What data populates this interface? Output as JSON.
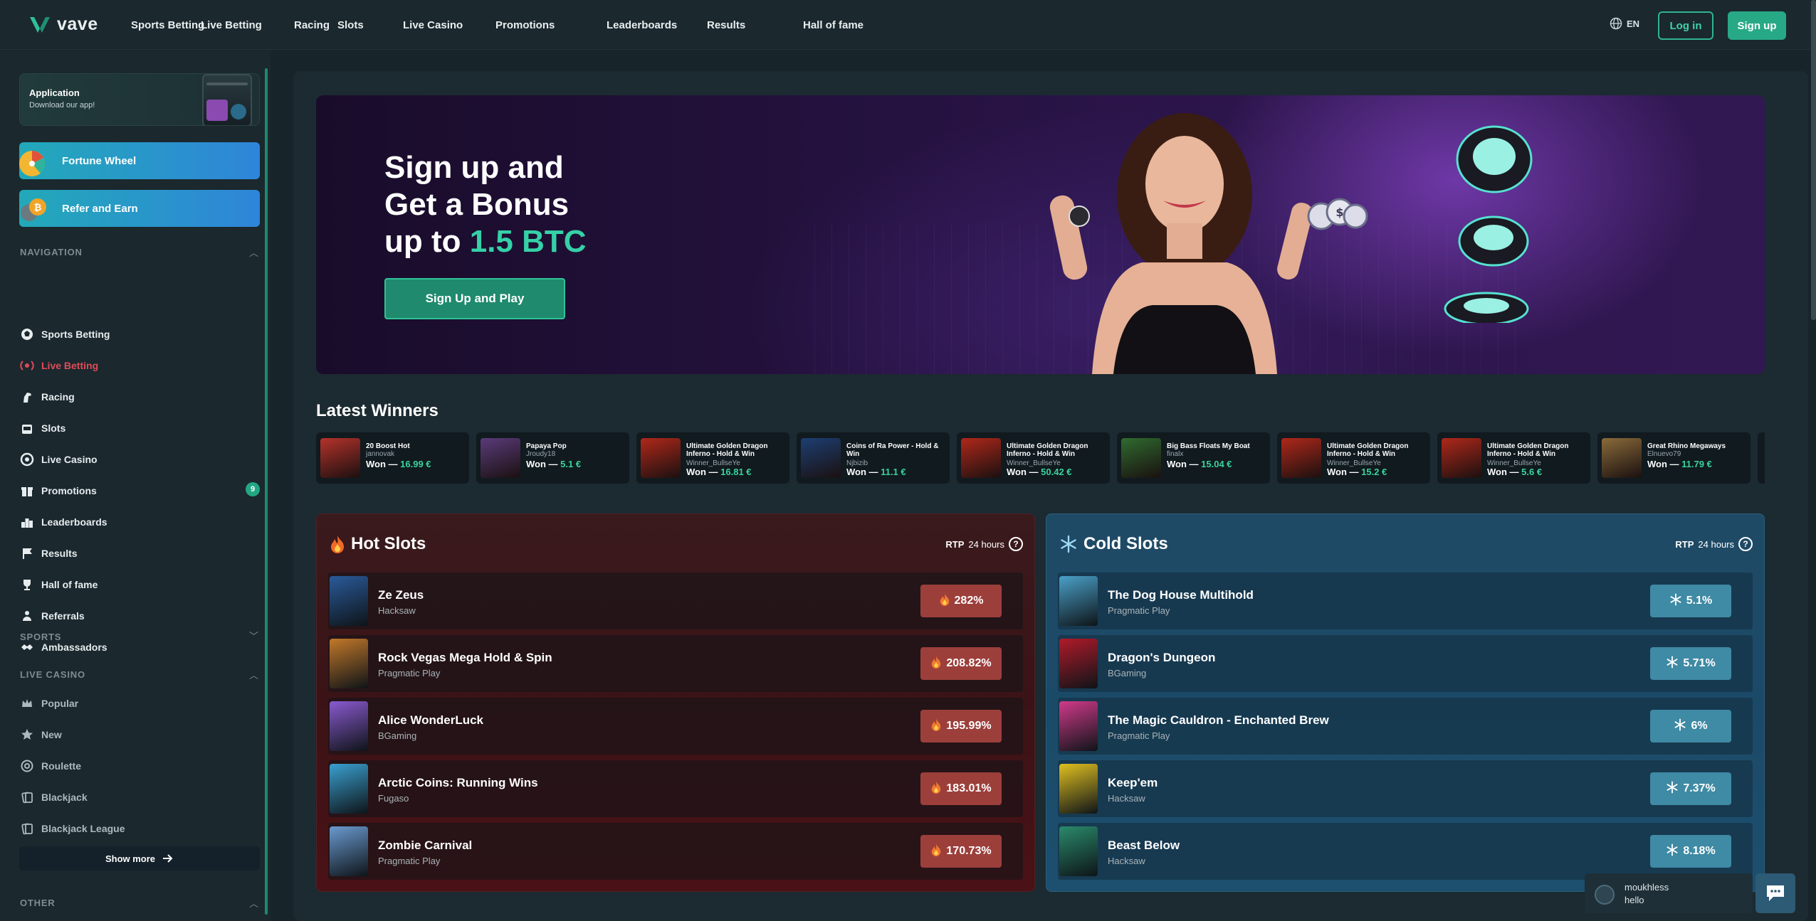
{
  "brand": {
    "name": "vave"
  },
  "topnav": [
    "Sports Betting",
    "Live Betting",
    "Racing",
    "Slots",
    "Live Casino",
    "Promotions",
    "Leaderboards",
    "Results",
    "Hall of fame"
  ],
  "lang": "EN",
  "auth": {
    "login": "Log in",
    "signup": "Sign up"
  },
  "sidebar": {
    "app": {
      "title": "Application",
      "subtitle": "Download our app!"
    },
    "promos": [
      "Fortune Wheel",
      "Refer and Earn"
    ],
    "navigation_title": "NAVIGATION",
    "navigation": [
      {
        "label": "Sports Betting",
        "icon": "football-icon"
      },
      {
        "label": "Live Betting",
        "icon": "live-icon",
        "active": true
      },
      {
        "label": "Racing",
        "icon": "horse-icon"
      },
      {
        "label": "Slots",
        "icon": "slot-machine-icon"
      },
      {
        "label": "Live Casino",
        "icon": "chip-icon"
      },
      {
        "label": "Promotions",
        "icon": "gift-icon",
        "badge": "9"
      },
      {
        "label": "Leaderboards",
        "icon": "leaderboard-icon"
      },
      {
        "label": "Results",
        "icon": "flag-icon"
      },
      {
        "label": "Hall of fame",
        "icon": "trophy-icon"
      },
      {
        "label": "Referrals",
        "icon": "referral-icon"
      },
      {
        "label": "Ambassadors",
        "icon": "handshake-icon"
      }
    ],
    "sports_title": "SPORTS",
    "live_casino_title": "LIVE CASINO",
    "live_casino": [
      {
        "label": "Popular",
        "icon": "crown-icon"
      },
      {
        "label": "New",
        "icon": "star-icon"
      },
      {
        "label": "Roulette",
        "icon": "roulette-icon"
      },
      {
        "label": "Blackjack",
        "icon": "cards-icon"
      },
      {
        "label": "Blackjack League",
        "icon": "cards-icon"
      }
    ],
    "show_more": "Show more",
    "other_title": "OTHER"
  },
  "banner": {
    "line1": "Sign up and",
    "line2": "Get a Bonus",
    "line3_prefix": "up to ",
    "line3_accent": "1.5 BTC",
    "cta": "Sign Up and Play"
  },
  "latest_winners": {
    "title": "Latest Winners",
    "won_prefix": "Won — ",
    "items": [
      {
        "game": "20 Boost Hot",
        "user": "jannovak",
        "amount": "16.99 €",
        "color": "#b5322a"
      },
      {
        "game": "Papaya Pop",
        "user": "Jroudy18",
        "amount": "5.1 €",
        "color": "#5a3b7a"
      },
      {
        "game": "Ultimate Golden Dragon Inferno - Hold & Win",
        "user": "Winner_BullseYe",
        "amount": "16.81 €",
        "color": "#b0281a"
      },
      {
        "game": "Coins of Ra Power - Hold & Win",
        "user": "Njbizib",
        "amount": "11.1 €",
        "color": "#1d3f73"
      },
      {
        "game": "Ultimate Golden Dragon Inferno - Hold & Win",
        "user": "Winner_BullseYe",
        "amount": "50.42 €",
        "color": "#b0281a"
      },
      {
        "game": "Big Bass Floats My Boat",
        "user": "finalx",
        "amount": "15.04 €",
        "color": "#2f6b2f"
      },
      {
        "game": "Ultimate Golden Dragon Inferno - Hold & Win",
        "user": "Winner_BullseYe",
        "amount": "15.2 €",
        "color": "#b0281a"
      },
      {
        "game": "Ultimate Golden Dragon Inferno - Hold & Win",
        "user": "Winner_BullseYe",
        "amount": "5.6 €",
        "color": "#b0281a"
      },
      {
        "game": "Great Rhino Megaways",
        "user": "Elnuevo79",
        "amount": "11.79 €",
        "color": "#8a6b3a"
      }
    ]
  },
  "hot_slots": {
    "title": "Hot Slots",
    "rtp_label": "RTP",
    "rtp_period": "24 hours",
    "items": [
      {
        "name": "Ze Zeus",
        "provider": "Hacksaw",
        "pct": "282%",
        "color": "#2a5a9a"
      },
      {
        "name": "Rock Vegas Mega Hold & Spin",
        "provider": "Pragmatic Play",
        "pct": "208.82%",
        "color": "#c2782a"
      },
      {
        "name": "Alice WonderLuck",
        "provider": "BGaming",
        "pct": "195.99%",
        "color": "#8a5ad0"
      },
      {
        "name": "Arctic Coins: Running Wins",
        "provider": "Fugaso",
        "pct": "183.01%",
        "color": "#3aa0d0"
      },
      {
        "name": "Zombie Carnival",
        "provider": "Pragmatic Play",
        "pct": "170.73%",
        "color": "#6a9ad0"
      }
    ]
  },
  "cold_slots": {
    "title": "Cold Slots",
    "rtp_label": "RTP",
    "rtp_period": "24 hours",
    "items": [
      {
        "name": "The Dog House Multihold",
        "provider": "Pragmatic Play",
        "pct": "5.1%",
        "color": "#4aa0c8"
      },
      {
        "name": "Dragon's Dungeon",
        "provider": "BGaming",
        "pct": "5.71%",
        "color": "#b01a2a"
      },
      {
        "name": "The Magic Cauldron - Enchanted Brew",
        "provider": "Pragmatic Play",
        "pct": "6%",
        "color": "#d03a8a"
      },
      {
        "name": "Keep'em",
        "provider": "Hacksaw",
        "pct": "7.37%",
        "color": "#e0c020"
      },
      {
        "name": "Beast Below",
        "provider": "Hacksaw",
        "pct": "8.18%",
        "color": "#2a8a6a"
      }
    ]
  },
  "chat": {
    "user": "moukhless",
    "message": "hello"
  },
  "colors": {
    "accent": "#2fb393",
    "hot": "#9c3f3b",
    "cold": "#3f8aa4",
    "active_nav": "#e04b57"
  }
}
